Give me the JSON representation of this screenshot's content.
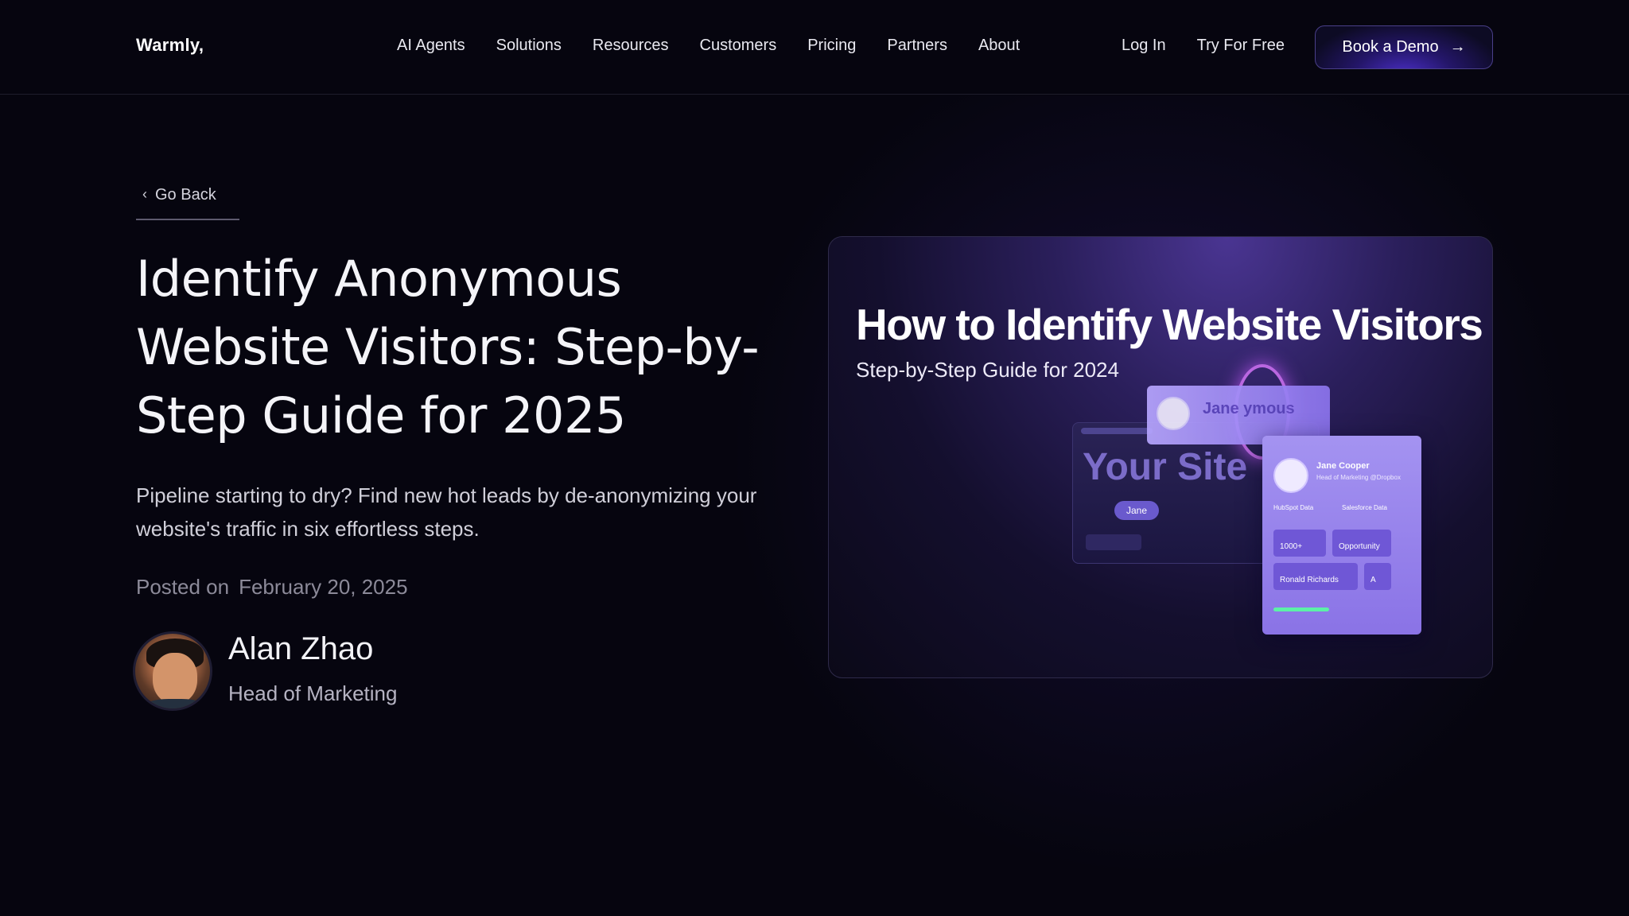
{
  "nav": {
    "logo": "Warmly,",
    "links": [
      "AI Agents",
      "Solutions",
      "Resources",
      "Customers",
      "Pricing",
      "Partners",
      "About"
    ],
    "login": "Log In",
    "try_free": "Try For Free",
    "demo_button": "Book a Demo",
    "demo_arrow": "→"
  },
  "back": {
    "chevron": "‹",
    "label": "Go Back"
  },
  "article": {
    "title": "Identify Anonymous Website Visitors: Step-by-Step Guide for 2025",
    "subtitle": "Pipeline starting to dry? Find new hot leads by de-anonymizing your website's traffic in six effortless steps.",
    "posted_label": "Posted on",
    "posted_date": "February 20, 2025",
    "author": {
      "name": "Alan Zhao",
      "role": "Head of Marketing"
    }
  },
  "hero": {
    "title": "How to Identify Website Visitors",
    "subtitle": "Step-by-Step Guide for 2024",
    "site_text": "Your Site",
    "pill": "Jane",
    "popup_name": "Jane",
    "popup_name_2": "ymous",
    "profile_name": "Jane Cooper",
    "profile_role": "Head of Marketing @Dropbox",
    "hubspot": "HubSpot Data",
    "salesforce": "Salesforce Data",
    "company_size": "1000+",
    "lifecycle": "Opportunity",
    "owner": "Ronald Richards",
    "grade": "A"
  },
  "colors": {
    "background": "#06050f",
    "accent": "#4b2fc9",
    "text": "#ffffff",
    "muted": "#8c8a99"
  }
}
